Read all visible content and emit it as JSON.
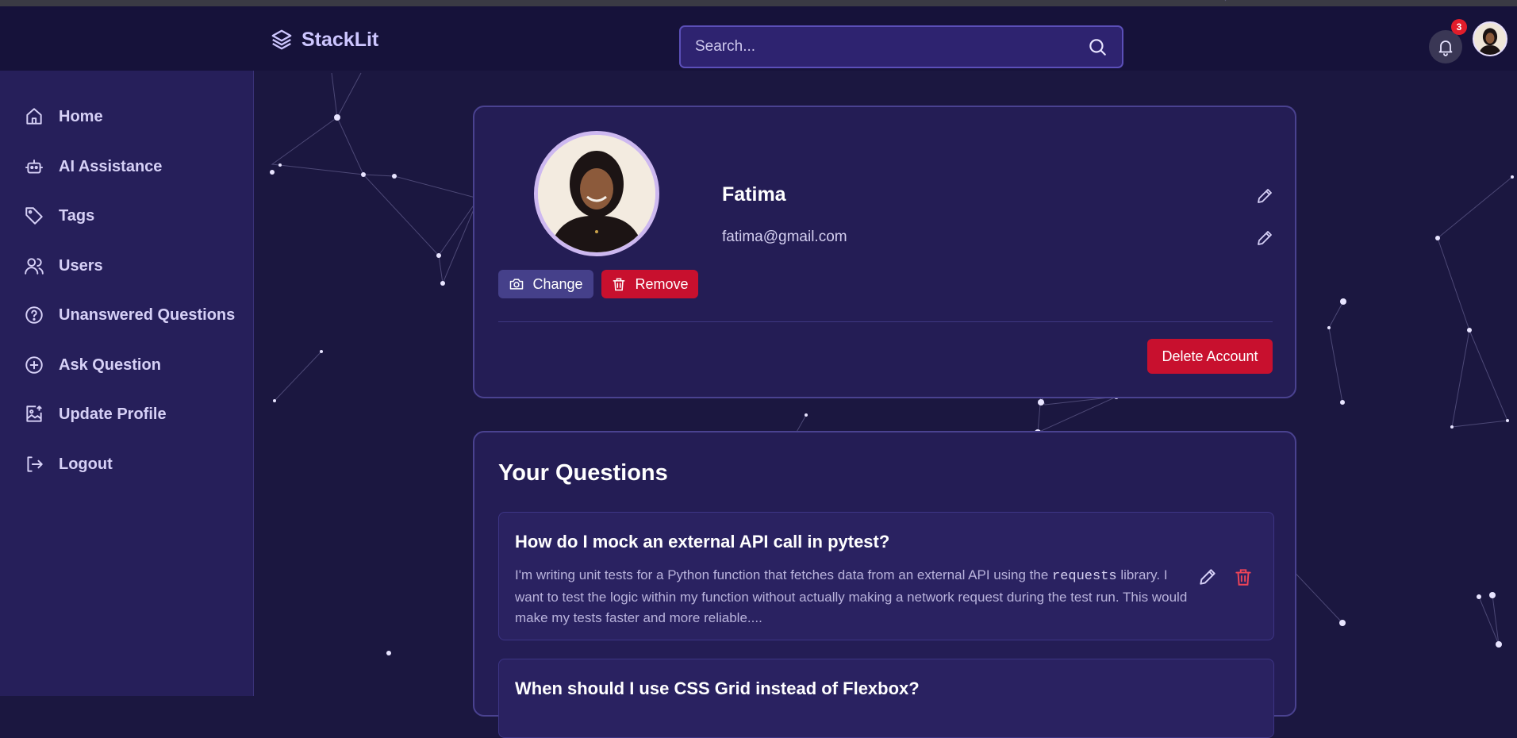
{
  "app": {
    "name": "StackLit"
  },
  "search": {
    "placeholder": "Search..."
  },
  "notifications": {
    "count": "3"
  },
  "sidebar": {
    "items": [
      {
        "label": "Home",
        "icon": "home-icon"
      },
      {
        "label": "AI Assistance",
        "icon": "robot-icon"
      },
      {
        "label": "Tags",
        "icon": "tag-icon"
      },
      {
        "label": "Users",
        "icon": "users-icon"
      },
      {
        "label": "Unanswered Questions",
        "icon": "question-circle-icon"
      },
      {
        "label": "Ask Question",
        "icon": "plus-circle-icon"
      },
      {
        "label": "Update Profile",
        "icon": "image-upload-icon"
      },
      {
        "label": "Logout",
        "icon": "logout-icon"
      }
    ]
  },
  "profile": {
    "name": "Fatima",
    "email": "fatima@gmail.com",
    "change_label": "Change",
    "remove_label": "Remove",
    "delete_label": "Delete Account"
  },
  "questions": {
    "title": "Your Questions",
    "items": [
      {
        "title": "How do I mock an external API call in pytest?",
        "body_before": "I'm writing unit tests for a Python function that fetches data from an external API using the ",
        "body_code": "requests",
        "body_after": " library. I want to test the logic within my function without actually making a network request during the test run. This would make my tests faster and more reliable...."
      },
      {
        "title": "When should I use CSS Grid instead of Flexbox?"
      }
    ]
  },
  "colors": {
    "background": "#1b1740",
    "sidebar": "#261f5a",
    "card": "#241d55",
    "accent": "#5b4fb8",
    "danger": "#c8102e"
  }
}
